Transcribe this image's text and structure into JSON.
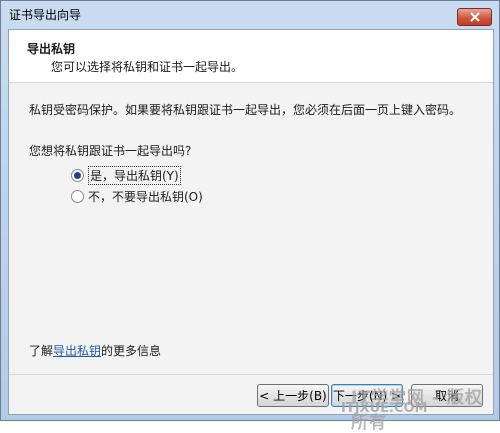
{
  "window": {
    "title": "证书导出向导",
    "close_icon": "close-icon"
  },
  "header": {
    "title": "导出私钥",
    "subtitle": "您可以选择将私钥和证书一起导出。"
  },
  "main": {
    "description": "私钥受密码保护。如果要将私钥跟证书一起导出，您必须在后面一页上键入密码。",
    "question": "您想将私钥跟证书一起导出吗?",
    "options": [
      {
        "label": "是，导出私钥(Y)",
        "selected": true
      },
      {
        "label": "不，不要导出私钥(O)",
        "selected": false
      }
    ],
    "learn_prefix": "了解",
    "learn_link": "导出私钥",
    "learn_suffix": "的更多信息"
  },
  "buttons": {
    "back": "< 上一步(B)",
    "next": "下一步(N) >",
    "cancel": "取消"
  },
  "watermark": {
    "line1": "IT学堂网 - 版权所有",
    "line2": "ITJXUE.COM"
  }
}
